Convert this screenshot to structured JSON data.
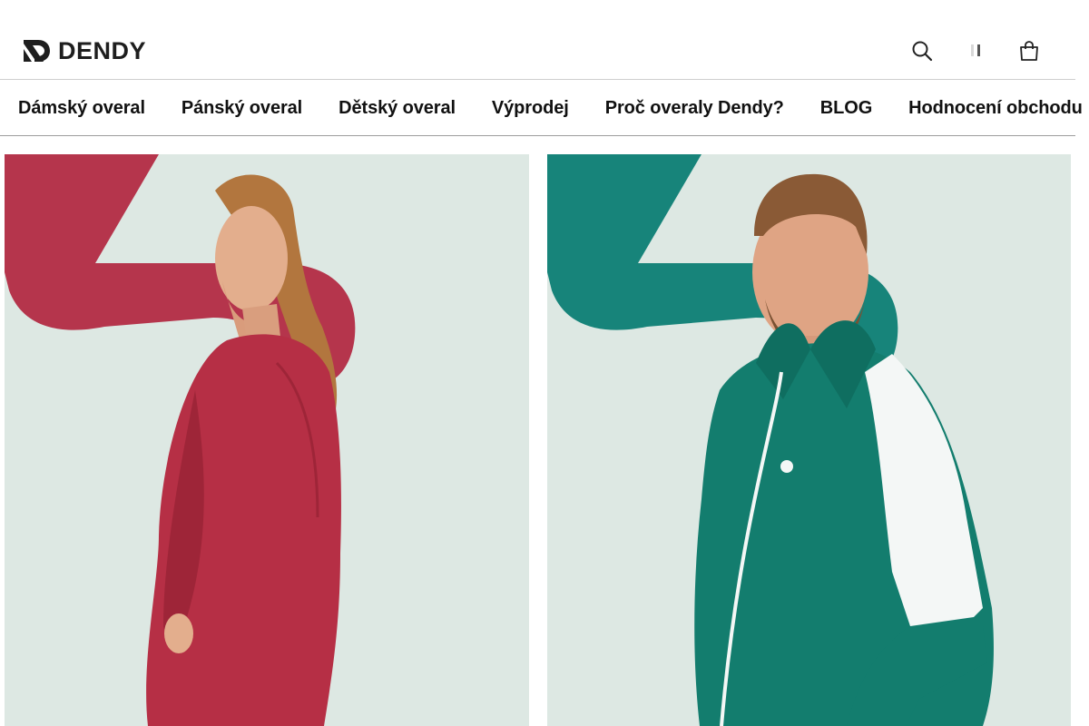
{
  "brand": {
    "name": "DENDY"
  },
  "header": {
    "user_icon_glyph": "👤"
  },
  "nav": {
    "items": [
      {
        "label": "Dámský overal"
      },
      {
        "label": "Pánský overal"
      },
      {
        "label": "Dětský overal"
      },
      {
        "label": "Výprodej"
      },
      {
        "label": "Proč overaly Dendy?"
      },
      {
        "label": "BLOG"
      },
      {
        "label": "Hodnocení obchodu"
      }
    ]
  },
  "tiles": [
    {
      "subject": "woman in red overall",
      "accent_color": "#b5354c",
      "background": "#dde8e3"
    },
    {
      "subject": "man in green tracksuit",
      "accent_color": "#17847a",
      "background": "#dde8e3"
    }
  ],
  "colors": {
    "text": "#111111",
    "divider": "#9c9c9c",
    "red_accent": "#b5354c",
    "green_accent": "#17847a",
    "tile_bg": "#dde8e3"
  }
}
